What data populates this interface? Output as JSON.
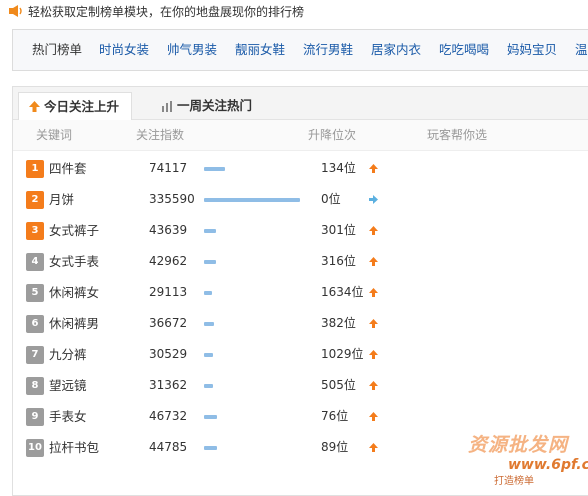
{
  "topbar": {
    "text": "轻松获取定制榜单模块，在你的地盘展现你的排行榜",
    "icon": "speaker-icon"
  },
  "nav": {
    "items": [
      {
        "label": "热门榜单",
        "active": true
      },
      {
        "label": "时尚女装",
        "active": false
      },
      {
        "label": "帅气男装",
        "active": false
      },
      {
        "label": "靓丽女鞋",
        "active": false
      },
      {
        "label": "流行男鞋",
        "active": false
      },
      {
        "label": "居家内衣",
        "active": false
      },
      {
        "label": "吃吃喝喝",
        "active": false
      },
      {
        "label": "妈妈宝贝",
        "active": false
      },
      {
        "label": "温",
        "active": false
      }
    ]
  },
  "tabs": [
    {
      "label": "今日关注上升",
      "icon": "up-arrow-icon",
      "active": true
    },
    {
      "label": "一周关注热门",
      "icon": "bar-chart-icon",
      "active": false
    }
  ],
  "table": {
    "headers": [
      "关键词",
      "关注指数",
      "升降位次",
      "玩客帮你选"
    ],
    "rows": [
      {
        "rank": "1",
        "keyword": "四件套",
        "index": "74117",
        "index_value": 74117,
        "change": "134位",
        "trend": "up"
      },
      {
        "rank": "2",
        "keyword": "月饼",
        "index": "335590",
        "index_value": 335590,
        "change": "0位",
        "trend": "flat"
      },
      {
        "rank": "3",
        "keyword": "女式裤子",
        "index": "43639",
        "index_value": 43639,
        "change": "301位",
        "trend": "up"
      },
      {
        "rank": "4",
        "keyword": "女式手表",
        "index": "42962",
        "index_value": 42962,
        "change": "316位",
        "trend": "up"
      },
      {
        "rank": "5",
        "keyword": "休闲裤女",
        "index": "29113",
        "index_value": 29113,
        "change": "1634位",
        "trend": "up"
      },
      {
        "rank": "6",
        "keyword": "休闲裤男",
        "index": "36672",
        "index_value": 36672,
        "change": "382位",
        "trend": "up"
      },
      {
        "rank": "7",
        "keyword": "九分裤",
        "index": "30529",
        "index_value": 30529,
        "change": "1029位",
        "trend": "up"
      },
      {
        "rank": "8",
        "keyword": "望远镜",
        "index": "31362",
        "index_value": 31362,
        "change": "505位",
        "trend": "up"
      },
      {
        "rank": "9",
        "keyword": "手表女",
        "index": "46732",
        "index_value": 46732,
        "change": "76位",
        "trend": "up"
      },
      {
        "rank": "10",
        "keyword": "拉杆书包",
        "index": "44785",
        "index_value": 44785,
        "change": "89位",
        "trend": "up"
      }
    ]
  },
  "watermark": {
    "line1": "资源批发网",
    "line2": "www.6pf.cn",
    "line3": "打造榜单"
  },
  "colors": {
    "accent_orange": "#f47c1b",
    "rank_gray": "#9c9c9c",
    "bar_blue": "#8fbde6",
    "link_blue": "#1a5aa8",
    "flat_arrow": "#5bb0e0"
  }
}
